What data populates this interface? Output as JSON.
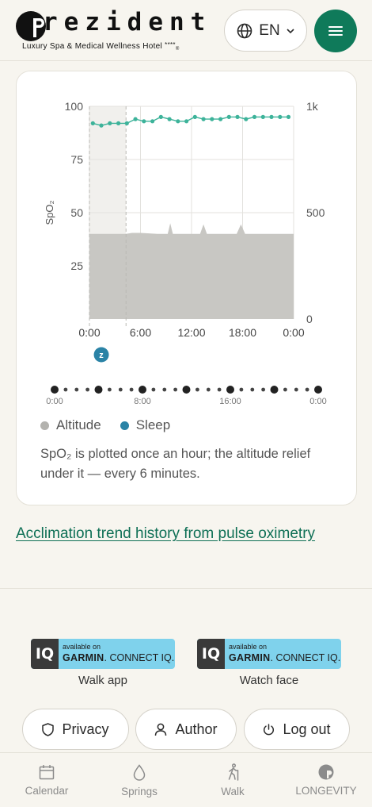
{
  "header": {
    "logo_word": "rezident",
    "logo_subtitle": "Luxury Spa & Medical Wellness Hotel",
    "logo_stars": "****",
    "logo_reg": "®",
    "language": "EN",
    "icons": {
      "language": "globe-icon",
      "dropdown": "chevron-down-icon",
      "menu": "hamburger-menu-icon"
    },
    "accent_color": "#0f7a5a"
  },
  "chart_data": {
    "type": "line",
    "title": "",
    "ylabel": "SpO₂",
    "y_ticks": [
      "100",
      "75",
      "50",
      "25"
    ],
    "ylim": [
      0,
      100
    ],
    "y2_ticks": [
      "1k",
      "500",
      "0"
    ],
    "y2lim": [
      0,
      1000
    ],
    "x_ticks": [
      "0:00",
      "6:00",
      "12:00",
      "18:00",
      "0:00"
    ],
    "x_hours": [
      0,
      6,
      12,
      18,
      24
    ],
    "sleep_band_hours": [
      0,
      4.3
    ],
    "sleep_marker_hour": 1.4,
    "sleep_marker_label": "z",
    "grid": true,
    "series": [
      {
        "name": "SpO2",
        "color": "#3db39a",
        "x": [
          0.4,
          1.4,
          2.4,
          3.4,
          4.4,
          5.4,
          6.4,
          7.4,
          8.4,
          9.4,
          10.4,
          11.4,
          12.4,
          13.4,
          14.4,
          15.4,
          16.4,
          17.4,
          18.4,
          19.4,
          20.4,
          21.4,
          22.4,
          23.4
        ],
        "y": [
          92,
          91,
          92,
          92,
          92,
          94,
          93,
          93,
          95,
          94,
          93,
          93,
          95,
          94,
          94,
          94,
          95,
          95,
          94,
          95,
          95,
          95,
          95,
          95
        ]
      },
      {
        "name": "Altitude",
        "color": "#b3b2ae",
        "x": [
          0,
          3.5,
          4.3,
          5,
          6,
          8,
          9.2,
          9.5,
          9.8,
          10.5,
          12,
          13,
          13.4,
          13.8,
          14.5,
          16,
          17.3,
          17.8,
          18.3,
          19,
          21,
          23,
          24
        ],
        "y": [
          400,
          400,
          400,
          405,
          405,
          400,
          400,
          450,
          400,
          400,
          400,
          400,
          445,
          400,
          400,
          400,
          400,
          445,
          400,
          400,
          400,
          400,
          400
        ]
      }
    ]
  },
  "timeline": {
    "labels": [
      "0:00",
      "8:00",
      "16:00",
      "0:00"
    ],
    "dot_count": 25,
    "major_every": 4
  },
  "legend": [
    {
      "label": "Altitude",
      "color": "#b3b2ae"
    },
    {
      "label": "Sleep",
      "color": "#2a83a6"
    }
  ],
  "note": "SpO₂ is plotted once an hour; the altitude relief under it — every 6 minutes.",
  "trend_link": "Acclimation trend history from pulse oximetry",
  "badges": [
    {
      "iq": "IQ",
      "available": "available on",
      "garmin": "GARMIN",
      "connect": ". CONNECT IQ.",
      "label": "Walk app"
    },
    {
      "iq": "IQ",
      "available": "available on",
      "garmin": "GARMIN",
      "connect": ". CONNECT IQ.",
      "label": "Watch face"
    }
  ],
  "buttons": {
    "privacy": "Privacy",
    "author": "Author",
    "logout": "Log out",
    "icons": {
      "privacy": "shield-icon",
      "author": "user-icon",
      "logout": "power-icon"
    }
  },
  "bottom_nav": [
    {
      "label": "Calendar",
      "icon": "calendar-icon"
    },
    {
      "label": "Springs",
      "icon": "drop-icon"
    },
    {
      "label": "Walk",
      "icon": "walker-icon"
    },
    {
      "label": "LONGEVITY",
      "icon": "longevity-logo-icon"
    }
  ]
}
